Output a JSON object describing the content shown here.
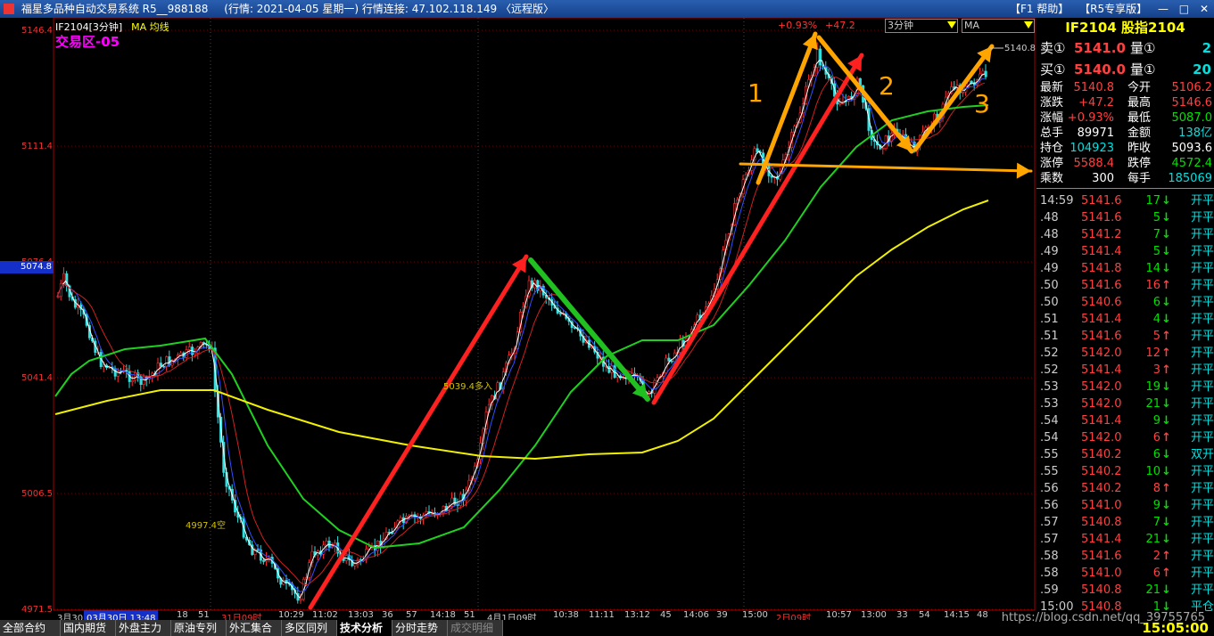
{
  "window": {
    "title_left": "福星多品种自动交易系统 R5__988188",
    "title_mid": "(行情: 2021-04-05 星期一)  行情连接: 47.102.118.149 〈远程版〉",
    "title_right": [
      "【F1 帮助】",
      "【R5专享版】",
      "—",
      "□",
      "✕"
    ]
  },
  "chart": {
    "header": "IF2104[3分钟]",
    "indicator": "MA 均线",
    "zone_label": "交易区-05",
    "change_pct": "+0.93%",
    "change_pts": "+47.2",
    "period_value": "3分钟",
    "indicator_value": "MA",
    "price_axis": [
      "5146.4",
      "5111.4",
      "5076.4",
      "5041.4",
      "5006.5",
      "4971.5"
    ],
    "price_marker": "5074.8",
    "last_price_tag": "5140.8",
    "ann_high": "5039.4多入",
    "ann_low": "4997.4空",
    "wave_labels": [
      "1",
      "2",
      "3"
    ],
    "x_labels": [
      {
        "t": "3月30",
        "red": false
      },
      {
        "t": "03月30日 13:48",
        "red": false
      },
      {
        "t": "18",
        "red": false
      },
      {
        "t": "51",
        "red": false
      },
      {
        "t": "31日09时",
        "red": true
      },
      {
        "t": "10:29",
        "red": false
      },
      {
        "t": "11:02",
        "red": false
      },
      {
        "t": "13:03",
        "red": false
      },
      {
        "t": "36",
        "red": false
      },
      {
        "t": "57",
        "red": false
      },
      {
        "t": "14:18",
        "red": false
      },
      {
        "t": "51",
        "red": false
      },
      {
        "t": "4月1日09时",
        "red": false
      },
      {
        "t": "10:38",
        "red": false
      },
      {
        "t": "11:11",
        "red": false
      },
      {
        "t": "13:12",
        "red": false
      },
      {
        "t": "45",
        "red": false
      },
      {
        "t": "14:06",
        "red": false
      },
      {
        "t": "39",
        "red": false
      },
      {
        "t": "15:00",
        "red": false
      },
      {
        "t": "2日09时",
        "red": true
      },
      {
        "t": "10:57",
        "red": false
      },
      {
        "t": "13:00",
        "red": false
      },
      {
        "t": "33",
        "red": false
      },
      {
        "t": "54",
        "red": false
      },
      {
        "t": "14:15",
        "red": false
      },
      {
        "t": "48",
        "red": false
      }
    ]
  },
  "quote": {
    "title": "IF2104 股指2104",
    "sell": {
      "label": "卖①",
      "price": "5141.0",
      "qty_label": "量①",
      "qty": "2"
    },
    "buy": {
      "label": "买①",
      "price": "5140.0",
      "qty_label": "量①",
      "qty": "20"
    },
    "rows": [
      {
        "l1": "最新",
        "v1": "5140.8",
        "c1": "#ff4040",
        "l2": "今开",
        "v2": "5106.2",
        "c2": "#ff4040"
      },
      {
        "l1": "涨跌",
        "v1": "+47.2",
        "c1": "#ff4040",
        "l2": "最高",
        "v2": "5146.6",
        "c2": "#ff4040"
      },
      {
        "l1": "涨幅",
        "v1": "+0.93%",
        "c1": "#ff4040",
        "l2": "最低",
        "v2": "5087.0",
        "c2": "#00e000"
      },
      {
        "l1": "总手",
        "v1": "89971",
        "c1": "#ffffff",
        "l2": "金额",
        "v2": "138亿",
        "c2": "#00e0e0"
      },
      {
        "l1": "持仓",
        "v1": "104923",
        "c1": "#00e0e0",
        "l2": "昨收",
        "v2": "5093.6",
        "c2": "#ffffff"
      },
      {
        "l1": "涨停",
        "v1": "5588.4",
        "c1": "#ff4040",
        "l2": "跌停",
        "v2": "4572.4",
        "c2": "#00e000"
      },
      {
        "l1": "乘数",
        "v1": "300",
        "c1": "#ffffff",
        "l2": "每手",
        "v2": "185069",
        "c2": "#00e0e0"
      }
    ],
    "ticks": [
      {
        "time": "14:59",
        "price": "5141.6",
        "vol": "17",
        "dir": "down",
        "type": "开平"
      },
      {
        "time": ".48",
        "price": "5141.6",
        "vol": "5",
        "dir": "down",
        "type": "开平"
      },
      {
        "time": ".48",
        "price": "5141.2",
        "vol": "7",
        "dir": "down",
        "type": "开平"
      },
      {
        "time": ".49",
        "price": "5141.4",
        "vol": "5",
        "dir": "down",
        "type": "开平"
      },
      {
        "time": ".49",
        "price": "5141.8",
        "vol": "14",
        "dir": "down",
        "type": "开平"
      },
      {
        "time": ".50",
        "price": "5141.6",
        "vol": "16",
        "dir": "up",
        "type": "开平"
      },
      {
        "time": ".50",
        "price": "5140.6",
        "vol": "6",
        "dir": "down",
        "type": "开平"
      },
      {
        "time": ".51",
        "price": "5141.4",
        "vol": "4",
        "dir": "down",
        "type": "开平"
      },
      {
        "time": ".51",
        "price": "5141.6",
        "vol": "5",
        "dir": "up",
        "type": "开平"
      },
      {
        "time": ".52",
        "price": "5142.0",
        "vol": "12",
        "dir": "up",
        "type": "开平"
      },
      {
        "time": ".52",
        "price": "5141.4",
        "vol": "3",
        "dir": "up",
        "type": "开平"
      },
      {
        "time": ".53",
        "price": "5142.0",
        "vol": "19",
        "dir": "down",
        "type": "开平"
      },
      {
        "time": ".53",
        "price": "5142.0",
        "vol": "21",
        "dir": "down",
        "type": "开平"
      },
      {
        "time": ".54",
        "price": "5141.4",
        "vol": "9",
        "dir": "down",
        "type": "开平"
      },
      {
        "time": ".54",
        "price": "5142.0",
        "vol": "6",
        "dir": "up",
        "type": "开平"
      },
      {
        "time": ".55",
        "price": "5140.2",
        "vol": "6",
        "dir": "down",
        "type": "双开"
      },
      {
        "time": ".55",
        "price": "5140.2",
        "vol": "10",
        "dir": "down",
        "type": "开平"
      },
      {
        "time": ".56",
        "price": "5140.2",
        "vol": "8",
        "dir": "up",
        "type": "开平"
      },
      {
        "time": ".56",
        "price": "5141.0",
        "vol": "9",
        "dir": "down",
        "type": "开平"
      },
      {
        "time": ".57",
        "price": "5140.8",
        "vol": "7",
        "dir": "down",
        "type": "开平"
      },
      {
        "time": ".57",
        "price": "5141.4",
        "vol": "21",
        "dir": "down",
        "type": "开平"
      },
      {
        "time": ".58",
        "price": "5141.6",
        "vol": "2",
        "dir": "up",
        "type": "开平"
      },
      {
        "time": ".58",
        "price": "5141.0",
        "vol": "6",
        "dir": "up",
        "type": "开平"
      },
      {
        "time": ".59",
        "price": "5140.8",
        "vol": "21",
        "dir": "down",
        "type": "开平"
      },
      {
        "time": "15:00",
        "price": "5140.8",
        "vol": "1",
        "dir": "down",
        "type": "平仓"
      }
    ]
  },
  "tabs": [
    "全部合约",
    "国内期货",
    "外盘主力",
    "原油专列",
    "外汇集合",
    "多区同列",
    "技术分析",
    "分时走势",
    "成交明细"
  ],
  "active_tab": "技术分析",
  "clock": "15:05:00",
  "watermark": "https://blog.csdn.net/qq_39755765"
}
